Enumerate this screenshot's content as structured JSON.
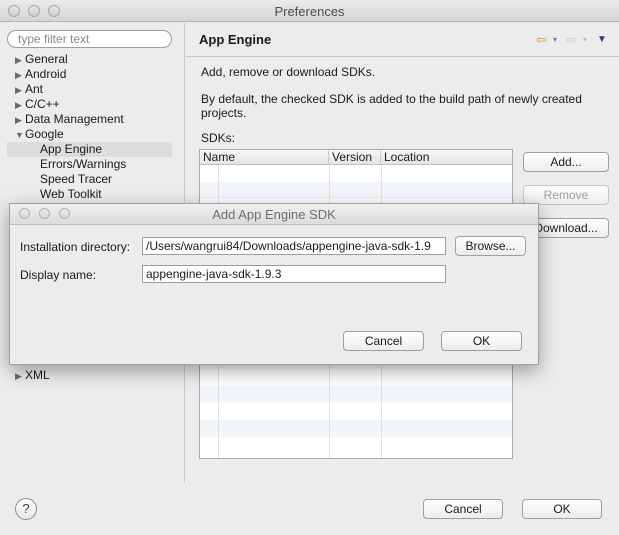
{
  "window": {
    "title": "Preferences"
  },
  "sidebar": {
    "filter_placeholder": "type filter text",
    "items": [
      {
        "label": "General"
      },
      {
        "label": "Android"
      },
      {
        "label": "Ant"
      },
      {
        "label": "C/C++"
      },
      {
        "label": "Data Management"
      },
      {
        "label": "Google"
      },
      {
        "label": "App Engine"
      },
      {
        "label": "Errors/Warnings"
      },
      {
        "label": "Speed Tracer"
      },
      {
        "label": "Web Toolkit"
      },
      {
        "label": "XML"
      }
    ]
  },
  "panel": {
    "title": "App Engine",
    "description": "Add, remove or download SDKs.",
    "note_line1": "By default, the checked SDK is added to the build path of newly created",
    "note_line2": "projects.",
    "sdks_label": "SDKs:",
    "columns": [
      "Name",
      "Version",
      "Location"
    ],
    "buttons": {
      "add": "Add...",
      "remove": "Remove",
      "download": "Download..."
    }
  },
  "footer": {
    "help": "?",
    "cancel": "Cancel",
    "ok": "OK"
  },
  "dialog": {
    "title": "Add App Engine SDK",
    "install_dir_label": "Installation directory:",
    "install_dir_value": "/Users/wangrui84/Downloads/appengine-java-sdk-1.9",
    "browse": "Browse...",
    "display_name_label": "Display name:",
    "display_name_value": "appengine-java-sdk-1.9.3",
    "cancel": "Cancel",
    "ok": "OK"
  }
}
